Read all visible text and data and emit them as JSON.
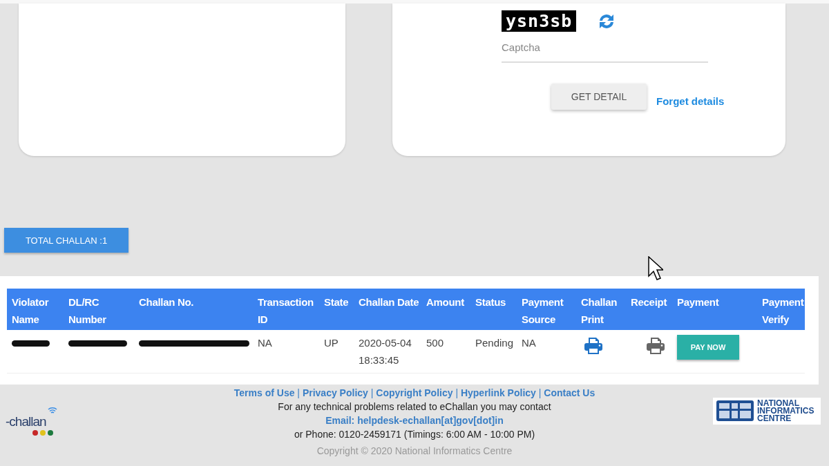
{
  "captcha": {
    "image_text": "ysn3sb",
    "placeholder": "Captcha"
  },
  "form_actions": {
    "button": "GET DETAIL",
    "link": "Forget details"
  },
  "total_button": "TOTAL CHALLAN :1",
  "table": {
    "columns": [
      "Violator Name",
      "DL/RC Number",
      "Challan No.",
      "Transaction ID",
      "State",
      "Challan Date",
      "Amount",
      "Status",
      "Payment Source",
      "Challan Print",
      "Receipt",
      "Payment",
      "Payment Verify"
    ],
    "rows": [
      {
        "cells": [
          {
            "kind": "redacted"
          },
          {
            "kind": "redacted"
          },
          {
            "kind": "redacted"
          },
          {
            "kind": "text",
            "text": "NA"
          },
          {
            "kind": "text",
            "text": "UP"
          },
          {
            "kind": "text",
            "text": "2020-05-04 18:33:45"
          },
          {
            "kind": "text",
            "text": "500"
          },
          {
            "kind": "text",
            "text": "Pending"
          },
          {
            "kind": "text",
            "text": "NA"
          },
          {
            "kind": "print",
            "active": true
          },
          {
            "kind": "print",
            "active": false
          },
          {
            "kind": "button",
            "text": "PAY NOW"
          },
          {
            "kind": "empty"
          }
        ]
      }
    ]
  },
  "footer": {
    "links": [
      "Terms of Use",
      "Privacy Policy",
      "Copyright Policy",
      "Hyperlink Policy",
      "Contact Us"
    ],
    "link_separator": "|",
    "contact_text": "For any technical problems related to eChallan you may contact",
    "email": "Email: helpdesk-echallan[at]gov[dot]in",
    "phone": "or Phone: 0120-2459171 (Timings: 6:00 AM - 10:00 PM)",
    "copyright": "Copyright © 2020 National Informatics Centre",
    "left_logo": "-challan",
    "right_logo": "NATIONAL INFORMATICS CENTRE"
  }
}
